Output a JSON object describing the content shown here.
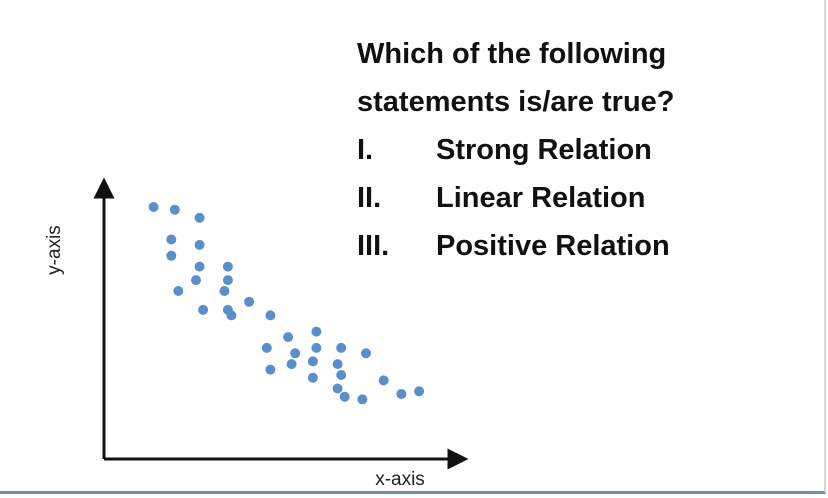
{
  "question": {
    "line1": "Which of the following",
    "line2": "statements is/are true?",
    "statements": [
      {
        "num": "I.",
        "text": "Strong Relation"
      },
      {
        "num": "II.",
        "text": "Linear Relation"
      },
      {
        "num": "III.",
        "text": "Positive Relation"
      }
    ]
  },
  "chart_data": {
    "type": "scatter",
    "xlabel": "x-axis",
    "ylabel": "y-axis",
    "xlim": [
      0,
      100
    ],
    "ylim": [
      0,
      100
    ],
    "grid": false,
    "point_color": "#5b8fc9",
    "points": [
      {
        "x": 14,
        "y": 93
      },
      {
        "x": 20,
        "y": 92
      },
      {
        "x": 27,
        "y": 89
      },
      {
        "x": 19,
        "y": 81
      },
      {
        "x": 27,
        "y": 79
      },
      {
        "x": 19,
        "y": 75
      },
      {
        "x": 27,
        "y": 71
      },
      {
        "x": 35,
        "y": 71
      },
      {
        "x": 26,
        "y": 66
      },
      {
        "x": 35,
        "y": 66
      },
      {
        "x": 21,
        "y": 62
      },
      {
        "x": 34,
        "y": 62
      },
      {
        "x": 28,
        "y": 55
      },
      {
        "x": 35,
        "y": 55
      },
      {
        "x": 41,
        "y": 58
      },
      {
        "x": 36,
        "y": 53
      },
      {
        "x": 47,
        "y": 53
      },
      {
        "x": 52,
        "y": 45
      },
      {
        "x": 60,
        "y": 47
      },
      {
        "x": 46,
        "y": 41
      },
      {
        "x": 54,
        "y": 39
      },
      {
        "x": 60,
        "y": 41
      },
      {
        "x": 67,
        "y": 41
      },
      {
        "x": 74,
        "y": 39
      },
      {
        "x": 53,
        "y": 35
      },
      {
        "x": 59,
        "y": 36
      },
      {
        "x": 66,
        "y": 35
      },
      {
        "x": 47,
        "y": 33
      },
      {
        "x": 59,
        "y": 30
      },
      {
        "x": 67,
        "y": 31
      },
      {
        "x": 79,
        "y": 29
      },
      {
        "x": 66,
        "y": 26
      },
      {
        "x": 68,
        "y": 23
      },
      {
        "x": 73,
        "y": 22
      },
      {
        "x": 84,
        "y": 24
      },
      {
        "x": 89,
        "y": 25
      }
    ]
  }
}
